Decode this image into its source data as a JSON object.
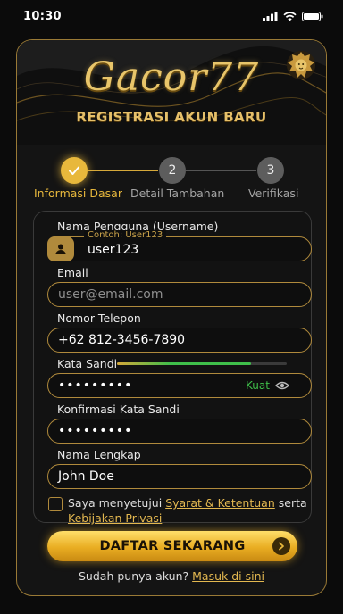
{
  "status_bar": {
    "time": "10:30"
  },
  "header": {
    "brand": "Gacor77",
    "subtitle": "REGISTRASI AKUN BARU"
  },
  "steps": [
    {
      "number": "1",
      "label": "Informasi Dasar",
      "state": "completed"
    },
    {
      "number": "2",
      "label": "Detail Tambahan",
      "state": "pending"
    },
    {
      "number": "3",
      "label": "Verifikasi",
      "state": "pending"
    }
  ],
  "form": {
    "username": {
      "label": "Nama Pengguna (Username)",
      "hint": "Contoh: User123",
      "value": "user123"
    },
    "email": {
      "label": "Email",
      "placeholder": "user@email.com",
      "value": ""
    },
    "phone": {
      "label": "Nomor Telepon",
      "value": "+62 812-3456-7890"
    },
    "password": {
      "label": "Kata Sandi",
      "value": "•••••••••",
      "strength_label": "Kuat",
      "strength_level": 0.79
    },
    "confirm_password": {
      "label": "Konfirmasi Kata Sandi",
      "value": "•••••••••"
    },
    "full_name": {
      "label": "Nama Lengkap",
      "value": "John Doe"
    }
  },
  "agreement": {
    "prefix": "Saya menyetujui",
    "terms_link": "Syarat & Ketentuan",
    "middle": "serta",
    "privacy_link": "Kebijakan Privasi",
    "checked": false
  },
  "submit": {
    "label": "DAFTAR SEKARANG"
  },
  "login_prompt": {
    "text": "Sudah punya akun?",
    "link": "Masuk di sini"
  },
  "colors": {
    "gold": "#e3b850",
    "strength_green": "#3fbf4a",
    "background": "#0b0b0b"
  },
  "icons": {
    "signal": "signal-icon",
    "wifi": "wifi-icon",
    "battery": "battery-icon",
    "logo": "lion-icon",
    "check": "check-icon",
    "user": "user-icon",
    "eye": "eye-icon",
    "arrow": "arrow-right-icon"
  }
}
